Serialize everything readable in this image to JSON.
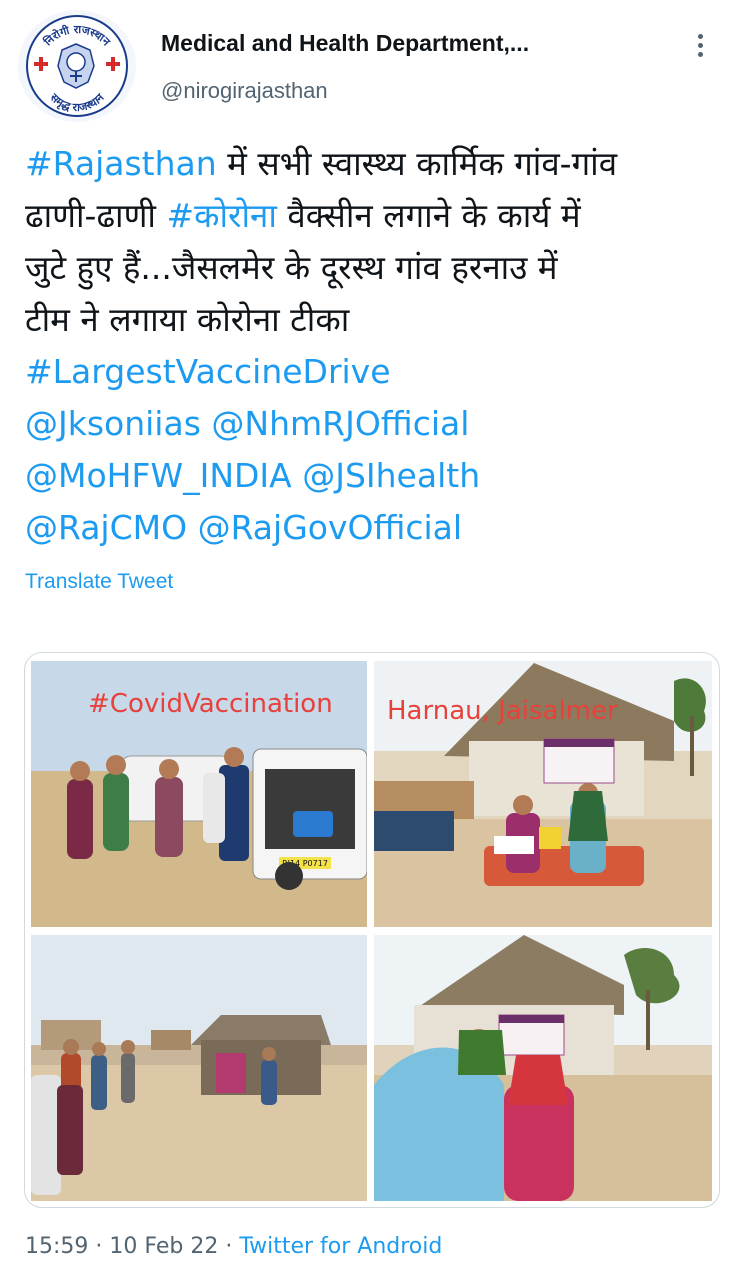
{
  "author": {
    "name": "Medical and Health Department,...",
    "handle": "@nirogirajasthan",
    "avatar": {
      "top_text": "निरोगी राजस्थान",
      "bottom_text": "समृद्ध राजस्थान",
      "color": "#1a3a8c"
    }
  },
  "tweet": {
    "lines": [
      [
        {
          "text": "#Rajasthan",
          "tag": true
        },
        {
          "text": " में सभी स्वास्थ्य कार्मिक गांव-गांव",
          "tag": false
        }
      ],
      [
        {
          "text": "ढाणी-ढाणी ",
          "tag": false
        },
        {
          "text": "#कोरोना",
          "tag": true
        },
        {
          "text": " वैक्सीन लगाने के कार्य में",
          "tag": false
        }
      ],
      [
        {
          "text": "जुटे हुए हैं...जैसलमेर के दूरस्थ गांव हरनाउ में",
          "tag": false
        }
      ],
      [
        {
          "text": "टीम ने लगाया कोरोना टीका",
          "tag": false
        }
      ],
      [
        {
          "text": "#LargestVaccineDrive",
          "tag": true
        }
      ],
      [
        {
          "text": "@Jksoniias",
          "tag": true
        },
        {
          "text": " ",
          "tag": false
        },
        {
          "text": "@NhmRJOfficial",
          "tag": true
        }
      ],
      [
        {
          "text": "@MoHFW_INDIA",
          "tag": true
        },
        {
          "text": " ",
          "tag": false
        },
        {
          "text": "@JSIhealth",
          "tag": true
        }
      ],
      [
        {
          "text": "@RajCMO",
          "tag": true
        },
        {
          "text": " ",
          "tag": false
        },
        {
          "text": "@RajGovOfficial",
          "tag": true
        }
      ]
    ]
  },
  "translate_label": "Translate Tweet",
  "media": {
    "photo1_caption": "#CovidVaccination",
    "photo2_caption": "Harnau, Jaisalmer",
    "photo1_plate": "RJ14 P0717"
  },
  "footer": {
    "time": "15:59",
    "sep1": " · ",
    "date": "10 Feb 22",
    "sep2": " · ",
    "source": "Twitter for Android"
  },
  "colors": {
    "link": "#1d9bf0",
    "muted": "#536471",
    "text": "#0f1419",
    "caption": "#e8413b"
  }
}
